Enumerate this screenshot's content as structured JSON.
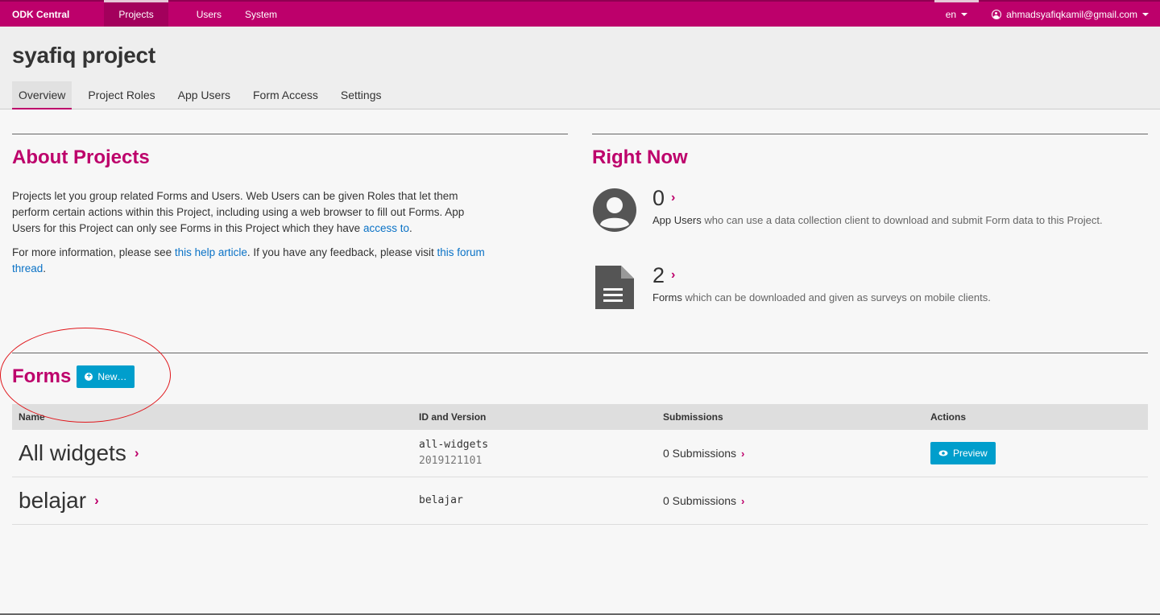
{
  "navbar": {
    "brand": "ODK Central",
    "items": [
      {
        "label": "Projects"
      },
      {
        "label": "Users"
      },
      {
        "label": "System"
      }
    ],
    "language": "en",
    "account": "ahmadsyafiqkamil@gmail.com",
    "color": "#bd006b"
  },
  "page": {
    "title": "syafiq project",
    "tabs": [
      {
        "label": "Overview"
      },
      {
        "label": "Project Roles"
      },
      {
        "label": "App Users"
      },
      {
        "label": "Form Access"
      },
      {
        "label": "Settings"
      }
    ]
  },
  "about": {
    "title": "About Projects",
    "p1_text": "Projects let you group related Forms and Users. Web Users can be given Roles that let them perform certain actions within this Project, including using a web browser to fill out Forms. App Users for this Project can only see Forms in this Project which they have ",
    "p1_link": "access to",
    "p1_end": ".",
    "p2_text": "For more information, please see ",
    "p2_link1": "this help article",
    "p2_mid": ". If you have any feedback, please visit ",
    "p2_link2": "this forum thread",
    "p2_end": "."
  },
  "right_now": {
    "title": "Right Now",
    "app_users": {
      "count": "0",
      "label": "App Users",
      "desc": " who can use a data collection client to download and submit Form data to this Project.",
      "icon": "user-circle-icon"
    },
    "forms": {
      "count": "2",
      "label": "Forms",
      "desc": " which can be downloaded and given as surveys on mobile clients.",
      "icon": "document-icon"
    }
  },
  "forms_section": {
    "title": "Forms",
    "new_button": "New…",
    "columns": [
      "Name",
      "ID and Version",
      "Submissions",
      "Actions"
    ],
    "rows": [
      {
        "name": "All widgets",
        "id": "all-widgets",
        "version": "2019121101",
        "submissions": "0 Submissions",
        "action": "Preview"
      },
      {
        "name": "belajar",
        "id": "belajar",
        "version": "",
        "submissions": "0 Submissions",
        "action": ""
      }
    ]
  }
}
